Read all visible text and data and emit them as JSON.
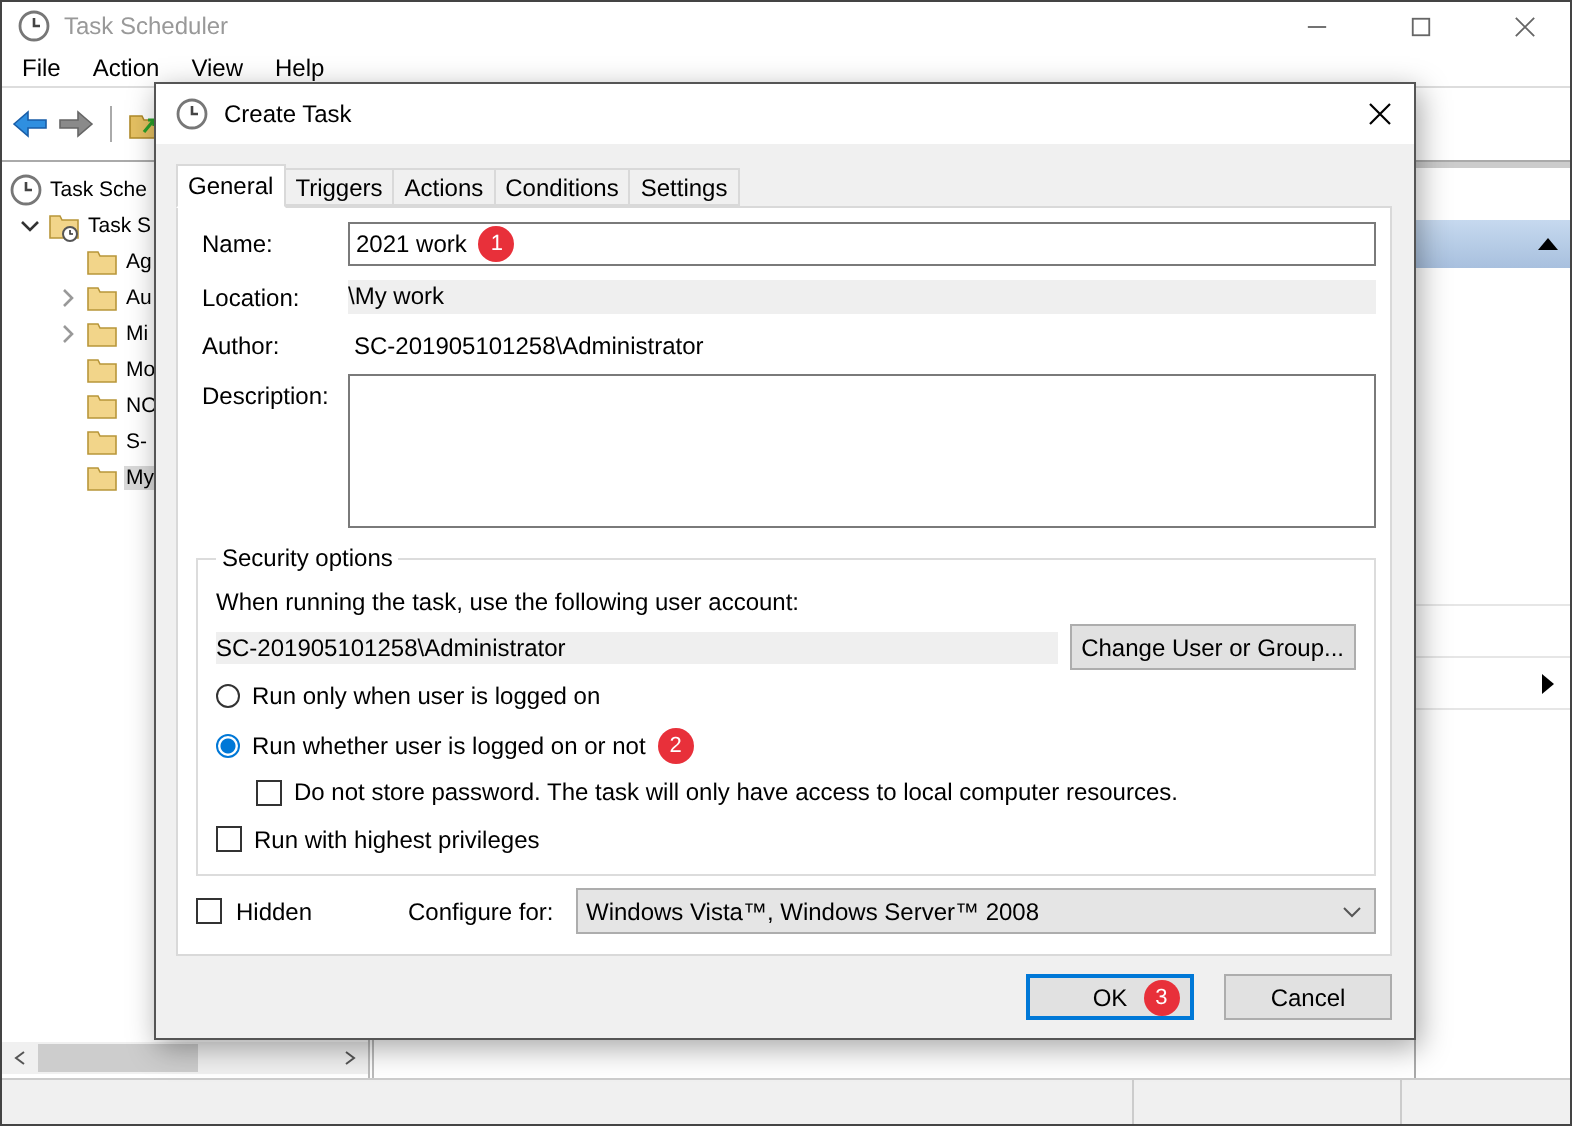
{
  "window": {
    "title": "Task Scheduler"
  },
  "menu": [
    {
      "label": "File"
    },
    {
      "label": "Action"
    },
    {
      "label": "View"
    },
    {
      "label": "Help"
    }
  ],
  "tree": [
    {
      "label": "Task Sche",
      "selected": false,
      "children": [
        {
          "label": "Task S",
          "expanded": true,
          "selected": false,
          "children": [
            {
              "label": "Ag",
              "selected": false
            },
            {
              "label": "Au",
              "expanded": false,
              "selected": false
            },
            {
              "label": "Mi",
              "expanded": false,
              "selected": false
            },
            {
              "label": "Mo",
              "selected": false
            },
            {
              "label": "NO",
              "selected": false
            },
            {
              "label": "S-",
              "selected": false
            },
            {
              "label": "My",
              "selected": true
            }
          ]
        }
      ]
    }
  ],
  "dialog": {
    "title": "Create Task",
    "tabs": [
      {
        "label": "General",
        "selected": true
      },
      {
        "label": "Triggers",
        "selected": false
      },
      {
        "label": "Actions",
        "selected": false
      },
      {
        "label": "Conditions",
        "selected": false
      },
      {
        "label": "Settings",
        "selected": false
      }
    ],
    "name": {
      "label": "Name:",
      "value": "2021 work",
      "badge": "1"
    },
    "location": {
      "label": "Location:",
      "value": "\\My work"
    },
    "author": {
      "label": "Author:",
      "value": "SC-201905101258\\Administrator"
    },
    "description": {
      "label": "Description:"
    },
    "security": {
      "title": "Security options",
      "prompt": "When running the task, use the following user account:",
      "account": "SC-201905101258\\Administrator",
      "change_button": "Change User or Group...",
      "options": [
        {
          "kind": "radio",
          "label": "Run only when user is logged on",
          "checked": false
        },
        {
          "kind": "radio",
          "label": "Run whether user is logged on or not",
          "checked": true,
          "badge": "2",
          "children": [
            {
              "kind": "checkbox",
              "label": "Do not store password.  The task will only have access to local computer resources.",
              "checked": false
            }
          ]
        },
        {
          "kind": "checkbox",
          "label": "Run with highest privileges",
          "checked": false
        }
      ]
    },
    "hidden": {
      "label": "Hidden",
      "checked": false
    },
    "configure": {
      "label": "Configure for:",
      "value": "Windows Vista™, Windows Server™ 2008"
    },
    "buttons": [
      {
        "label": "OK",
        "focused": true,
        "badge": "3"
      },
      {
        "label": "Cancel",
        "focused": false
      }
    ]
  }
}
